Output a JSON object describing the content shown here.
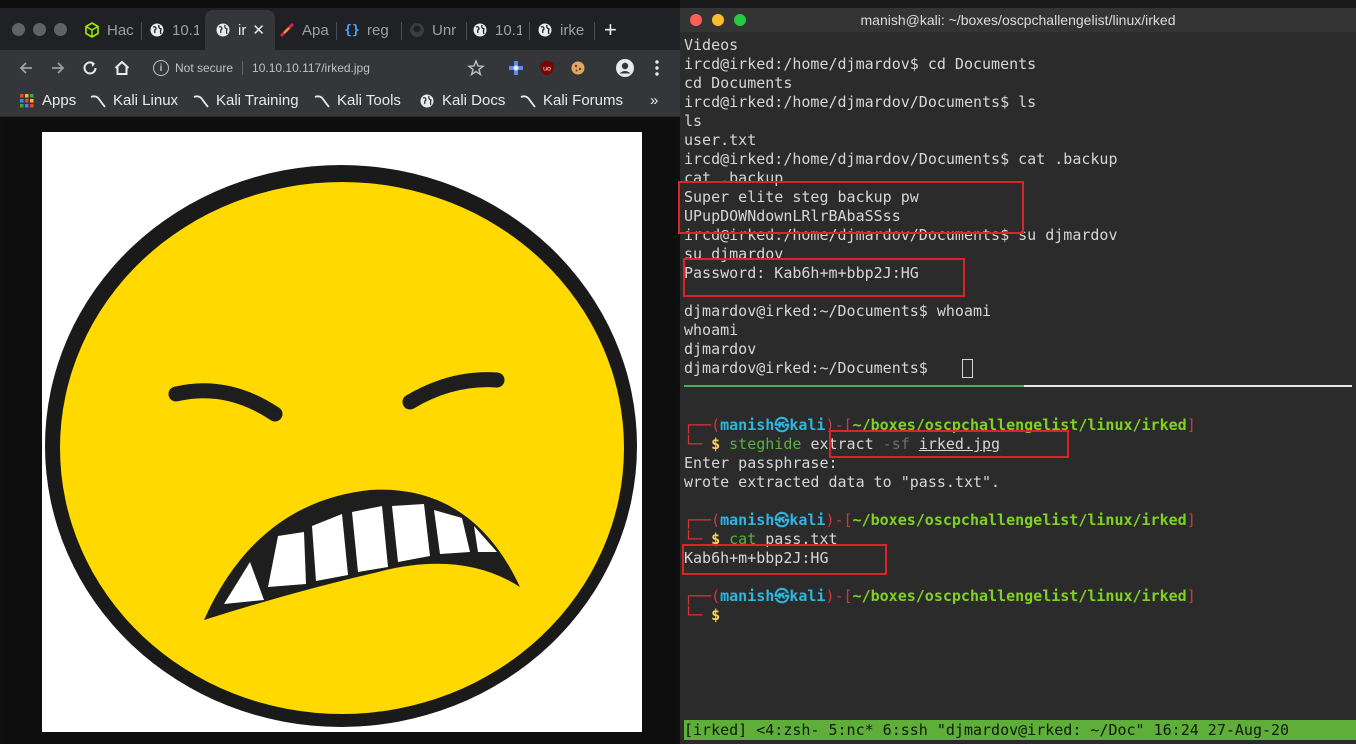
{
  "browser": {
    "tabs": [
      {
        "label": "Hac",
        "icon": "cube-icon"
      },
      {
        "label": "10.1",
        "icon": "globe-icon"
      },
      {
        "label": "ir",
        "icon": "globe-icon",
        "active": true
      },
      {
        "label": "Apa",
        "icon": "feather-icon"
      },
      {
        "label": "reg",
        "icon": "braces-icon"
      },
      {
        "label": "Unr",
        "icon": "github-icon"
      },
      {
        "label": "10.1",
        "icon": "globe-icon"
      },
      {
        "label": "irke",
        "icon": "globe-icon"
      }
    ],
    "security_label": "Not secure",
    "url": "10.10.10.117/irked.jpg",
    "bookmarks": [
      "Apps",
      "Kali Linux",
      "Kali Training",
      "Kali Tools",
      "Kali Docs",
      "Kali Forums"
    ],
    "more_bookmarks": "»",
    "image_description": "angry yellow emoji (irked.jpg)"
  },
  "terminal": {
    "title": "manish@kali: ~/boxes/oscpchallengelist/linux/irked",
    "top_pane": [
      "Videos",
      "ircd@irked:/home/djmardov$ cd Documents",
      "cd Documents",
      "ircd@irked:/home/djmardov/Documents$ ls",
      "ls",
      "user.txt",
      "ircd@irked:/home/djmardov/Documents$ cat .backup",
      "cat .backup",
      "Super elite steg backup pw",
      "UPupDOWNdownLRlrBAbaSSss",
      "ircd@irked:/home/djmardov/Documents$ su djmardov",
      "su djmardov",
      "Password: Kab6h+m+bbp2J:HG",
      "",
      "djmardov@irked:~/Documents$ whoami",
      "whoami",
      "djmardov",
      "djmardov@irked:~/Documents$ "
    ],
    "prompt": {
      "open": "┌──(",
      "user": "manish",
      "at": "㉿",
      "host": "kali",
      "mid": ")-[",
      "path": "~/boxes/oscpchallengelist/linux/irked",
      "close": "]",
      "corner": "└─",
      "dollar": "$"
    },
    "cmd1": {
      "bin": "steghide",
      "arg1": "extract",
      "arg2": "-sf",
      "arg3": "irked.jpg"
    },
    "out1": [
      "Enter passphrase:",
      "wrote extracted data to \"pass.txt\"."
    ],
    "cmd2": {
      "bin": "cat",
      "arg1": "pass.txt"
    },
    "out2": "Kab6h+m+bbp2J:HG",
    "status_bar": "[irked] <4:zsh- 5:nc* 6:ssh \"djmardov@irked: ~/Doc\" 16:24 27-Aug-20"
  },
  "colors": {
    "prompt_user": "#2fb6e0",
    "prompt_frame": "#d7353a",
    "prompt_path": "#7ed321",
    "highlight_box": "#d8252a",
    "tmux_bar": "#5fae3a"
  }
}
